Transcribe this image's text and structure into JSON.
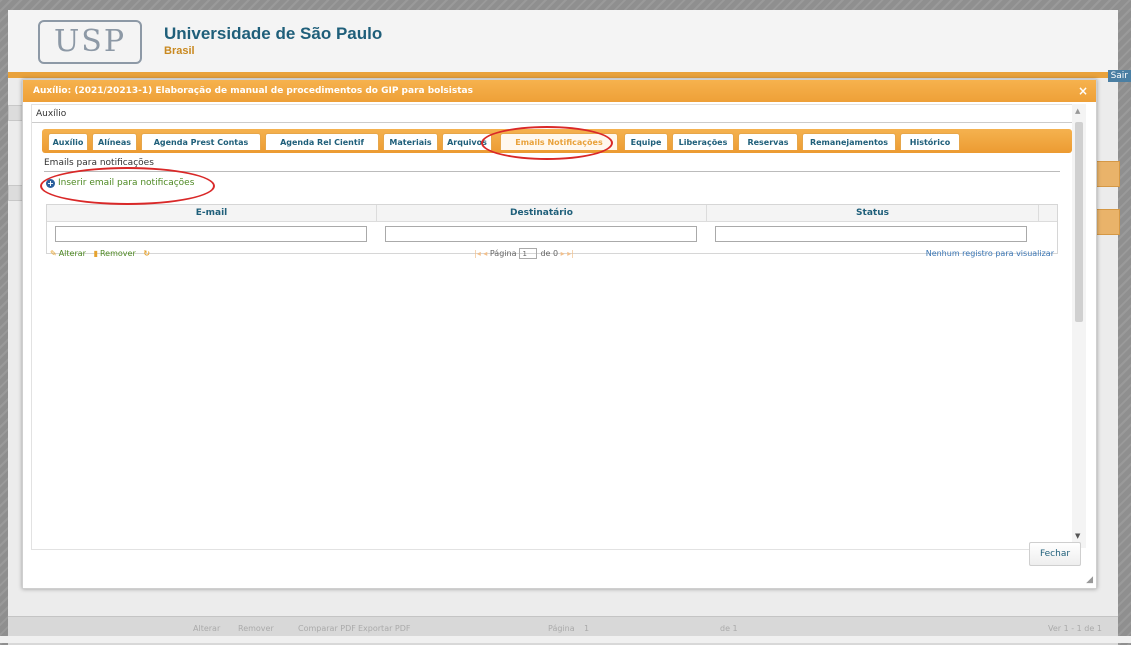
{
  "app": {
    "university_name": "Universidade de São Paulo",
    "country": "Brasil",
    "logo_text": "USP",
    "logout_label": "Sair"
  },
  "dialog": {
    "title": "Auxílio: (2021/20213-1) Elaboração de manual de procedimentos do GIP para bolsistas",
    "close_label": "×",
    "panel_label": "Auxílio",
    "tabs": [
      {
        "label": "Auxílio"
      },
      {
        "label": "Alíneas"
      },
      {
        "label": "Agenda Prest Contas"
      },
      {
        "label": "Agenda Rel Cientif"
      },
      {
        "label": "Materiais"
      },
      {
        "label": "Arquivos"
      },
      {
        "label": "Emails Notificações",
        "active": true
      },
      {
        "label": "Equipe"
      },
      {
        "label": "Liberações"
      },
      {
        "label": "Reservas"
      },
      {
        "label": "Remanejamentos"
      },
      {
        "label": "Histórico"
      }
    ],
    "section_label": "Emails para notificações",
    "add_label": "Inserir email para notificações",
    "grid": {
      "columns": [
        "E-mail",
        "Destinatário",
        "Status"
      ],
      "alter_label": "Alterar",
      "remove_label": "Remover",
      "page_label": "Página",
      "page_value": "1",
      "page_of": "de 0",
      "no_records": "Nenhum registro para visualizar"
    },
    "close_button": "Fechar"
  },
  "background": {
    "bottom_alter": "Alterar",
    "bottom_remove": "Remover",
    "bottom_pdf": "Comparar PDF",
    "bottom_export": "Exportar PDF",
    "bottom_page": "Página",
    "bottom_page_value": "1",
    "bottom_page_of": "de 1",
    "bottom_records": "Ver 1 - 1 de 1"
  },
  "colors": {
    "accent_orange": "#ec9b32",
    "brand_blue": "#1f5f7a",
    "highlight_red": "#d92828"
  }
}
